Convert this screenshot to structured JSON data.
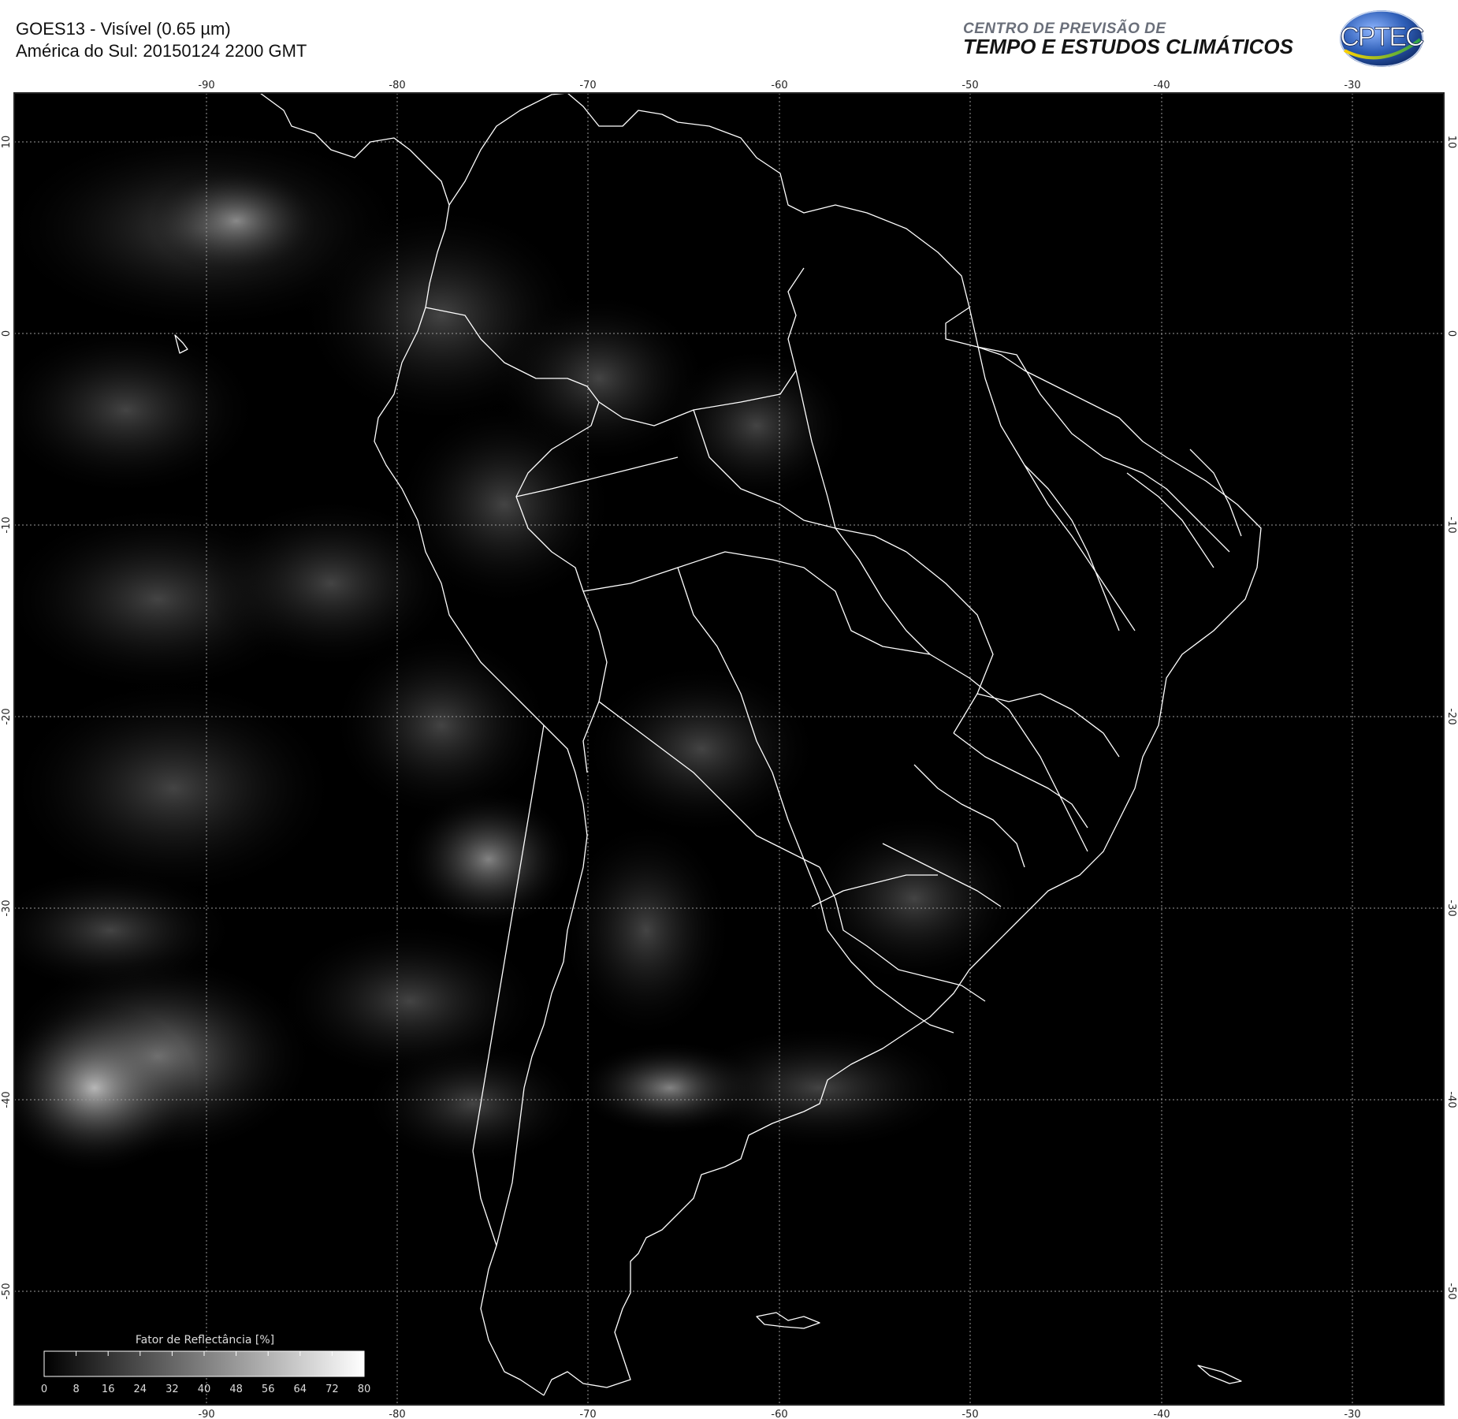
{
  "header": {
    "title_line1": "GOES13 - Visível (0.65 µm)",
    "title_line2": "América do Sul: 20150124 2200 GMT",
    "org_line1": "CENTRO DE PREVISÃO DE",
    "org_line2": "TEMPO E ESTUDOS CLIMÁTICOS",
    "logo_text": "CPTEC"
  },
  "axes": {
    "longitudes": [
      "-90",
      "-80",
      "-70",
      "-60",
      "-50",
      "-40",
      "-30"
    ],
    "latitudes": [
      "10",
      "0",
      "-10",
      "-20",
      "-30",
      "-40",
      "-50"
    ]
  },
  "colorbar": {
    "title": "Fator de Reflectância [%]",
    "ticks": [
      "0",
      "8",
      "16",
      "24",
      "32",
      "40",
      "48",
      "56",
      "64",
      "72",
      "80"
    ]
  },
  "colors": {
    "background": "#000000",
    "coastline": "#ffffff",
    "grid": "#9a9a9a"
  }
}
